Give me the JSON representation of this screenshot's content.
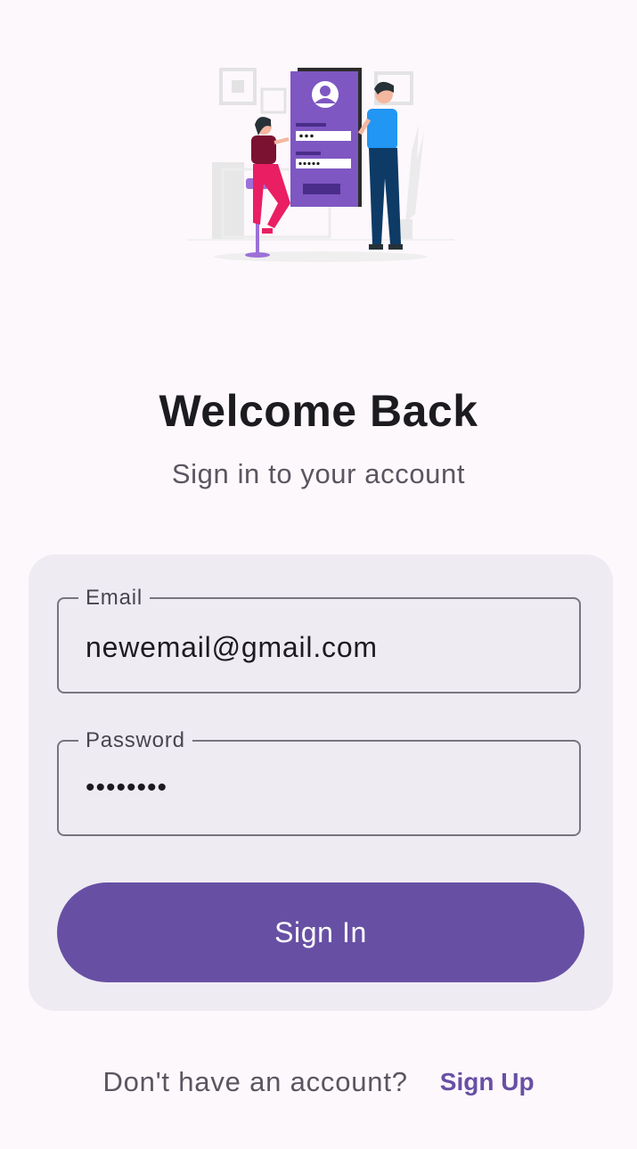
{
  "header": {
    "illustration_icon": "login-illustration",
    "title": "Welcome Back",
    "subtitle": "Sign in to your account"
  },
  "form": {
    "email": {
      "label": "Email",
      "value": "newemail@gmail.com"
    },
    "password": {
      "label": "Password",
      "value": "••••••••"
    },
    "submit_label": "Sign In"
  },
  "footer": {
    "prompt": "Don't have an account?",
    "link_label": "Sign Up"
  },
  "colors": {
    "background": "#fdf8fc",
    "card": "#efebf3",
    "primary": "#6750a4",
    "illustration_purple": "#7e57c2",
    "text": "#1c1b1f"
  }
}
